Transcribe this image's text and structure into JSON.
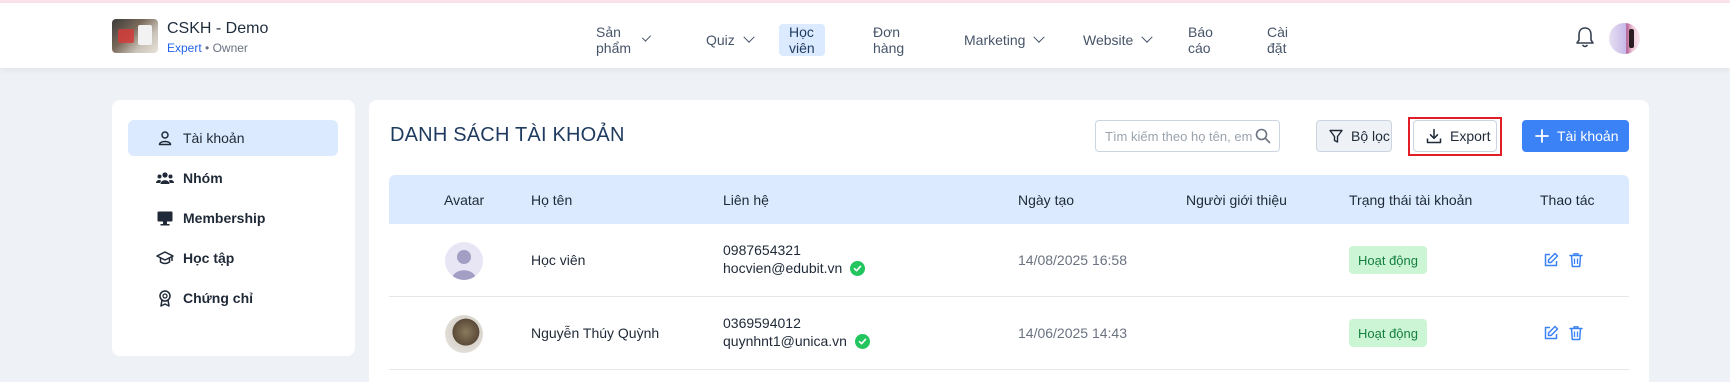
{
  "brand": {
    "name": "CSKH - Demo",
    "plan": "Expert",
    "separator": " • ",
    "role": "Owner"
  },
  "nav": {
    "items": [
      {
        "label": "Sản phẩm",
        "dropdown": true
      },
      {
        "label": "Quiz",
        "dropdown": true
      },
      {
        "label": "Học viên",
        "dropdown": false,
        "active": true
      },
      {
        "label": "Đơn hàng",
        "dropdown": false
      },
      {
        "label": "Marketing",
        "dropdown": true
      },
      {
        "label": "Website",
        "dropdown": true
      },
      {
        "label": "Báo cáo",
        "dropdown": false
      },
      {
        "label": "Cài đặt",
        "dropdown": false
      }
    ]
  },
  "sidebar": {
    "items": [
      {
        "label": "Tài khoản",
        "icon": "user-icon",
        "active": true
      },
      {
        "label": "Nhóm",
        "icon": "group-icon"
      },
      {
        "label": "Membership",
        "icon": "monitor-icon"
      },
      {
        "label": "Học tập",
        "icon": "graduation-cap-icon"
      },
      {
        "label": "Chứng chỉ",
        "icon": "certificate-icon"
      }
    ]
  },
  "main": {
    "title": "DANH SÁCH TÀI KHOẢN",
    "search_placeholder": "Tìm kiếm theo họ tên, em",
    "filter_label": "Bộ lọc",
    "export_label": "Export",
    "add_label": "Tài khoản"
  },
  "table": {
    "headers": [
      "Avatar",
      "Họ tên",
      "Liên hệ",
      "Ngày tạo",
      "Người giới thiệu",
      "Trạng thái tài khoản",
      "Thao tác"
    ],
    "rows": [
      {
        "avatar": "placeholder",
        "name": "Học viên",
        "phone": "0987654321",
        "email": "hocvien@edubit.vn",
        "verified": true,
        "created": "14/08/2025 16:58",
        "referrer": "",
        "status": "Hoạt động"
      },
      {
        "avatar": "photo",
        "name": "Nguyễn Thúy Quỳnh",
        "phone": "0369594012",
        "email": "quynhnt1@unica.vn",
        "verified": true,
        "created": "14/06/2025 14:43",
        "referrer": "",
        "status": "Hoạt động"
      }
    ]
  },
  "colors": {
    "accent": "#3b82f6",
    "header_row": "#dbeafe",
    "status_bg": "#ccf5d6",
    "status_text": "#15803d",
    "highlight": "#e11d26"
  }
}
